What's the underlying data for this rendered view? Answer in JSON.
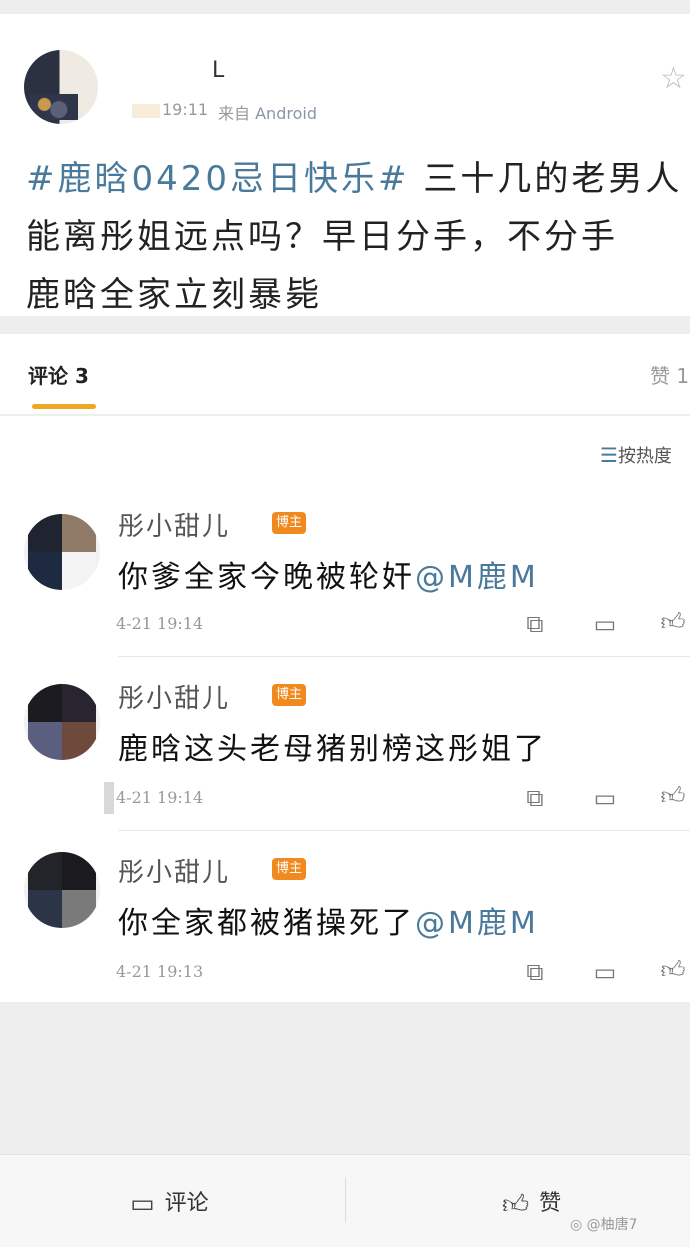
{
  "post": {
    "username": "L",
    "time": "19:11",
    "source_prefix": "来自",
    "source": "Android",
    "star_icon": "star-icon",
    "hashtag": "#鹿晗0420忌日快乐#",
    "text_line1": " 三十几的老男人",
    "text_line2": "能离彤姐远点吗？早日分手，不分手",
    "text_line3": "鹿晗全家立刻暴毙"
  },
  "tabs": {
    "comments_label": "评论 3",
    "likes_label": "赞 1",
    "sort_label": "按热度",
    "underline_color": "#f0a824"
  },
  "comments": [
    {
      "name": "彤小甜儿",
      "badge": "博主",
      "text": "你爹全家今晚被轮奸",
      "mention": "@M鹿M",
      "date": "4-21 19:14"
    },
    {
      "name": "彤小甜儿",
      "badge": "博主",
      "text": "鹿晗这头老母猪别榜这彤姐了",
      "mention": "",
      "date": "4-21 19:14"
    },
    {
      "name": "彤小甜儿",
      "badge": "博主",
      "text": "你全家都被猪操死了",
      "mention": "@M鹿M",
      "date": "4-21 19:13"
    }
  ],
  "bottom": {
    "comment_label": "评论",
    "like_label": "赞",
    "watermark": "@柚唐7"
  },
  "colors": {
    "link": "#4a7a9b",
    "badge": "#f08a1f"
  }
}
